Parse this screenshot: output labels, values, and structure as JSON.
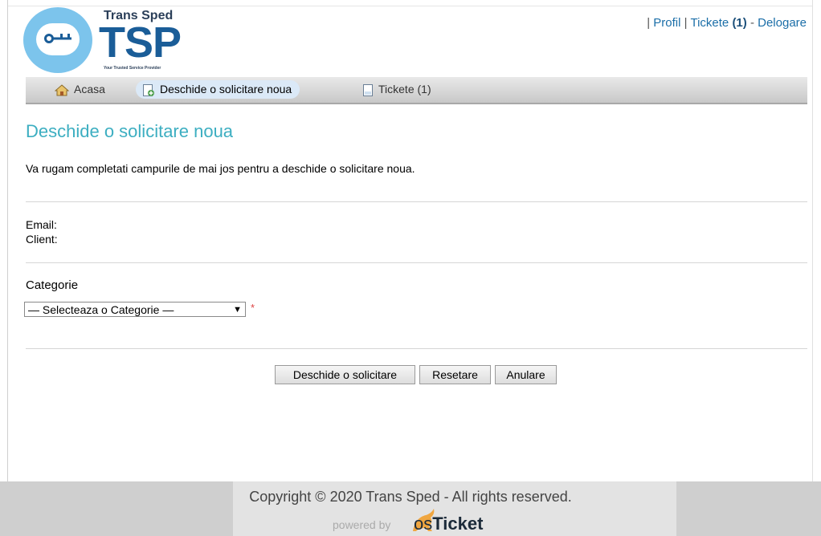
{
  "brand": {
    "name": "Trans Sped",
    "acronym": "TSP",
    "tagline": "Your Trusted Service Provider"
  },
  "toplinks": {
    "sep1": "|",
    "profil": "Profil",
    "sep2": "|",
    "tickete": "Tickete",
    "tickete_count": "(1)",
    "dash": "-",
    "delogare": "Delogare"
  },
  "nav": {
    "items": [
      {
        "label": "Acasa",
        "icon": "home-icon"
      },
      {
        "label": "Deschide o solicitare noua",
        "icon": "new-ticket-icon",
        "active": true
      },
      {
        "label": "Tickete (1)",
        "icon": "tickets-icon"
      }
    ]
  },
  "page": {
    "title": "Deschide o solicitare noua",
    "intro": "Va rugam completati campurile de mai jos pentru a deschide o solicitare noua."
  },
  "form": {
    "email_label": "Email:",
    "client_label": "Client:",
    "category_label": "Categorie",
    "category_selected": "— Selecteaza o Categorie —",
    "required_mark": "*"
  },
  "buttons": {
    "submit": "Deschide o solicitare",
    "reset": "Resetare",
    "cancel": "Anulare"
  },
  "footer": {
    "copyright": "Copyright © 2020 Trans Sped - All rights reserved.",
    "powered_by": "powered by",
    "os": "os",
    "ticket": "Ticket"
  },
  "colors": {
    "title": "#3caec1",
    "brand_blue": "#1a5d98",
    "logo_circle": "#7cc4ec",
    "link": "#1b6ea8",
    "nav_active_bg": "#dbe9f7",
    "footer_bg": "#cfcfcf"
  }
}
